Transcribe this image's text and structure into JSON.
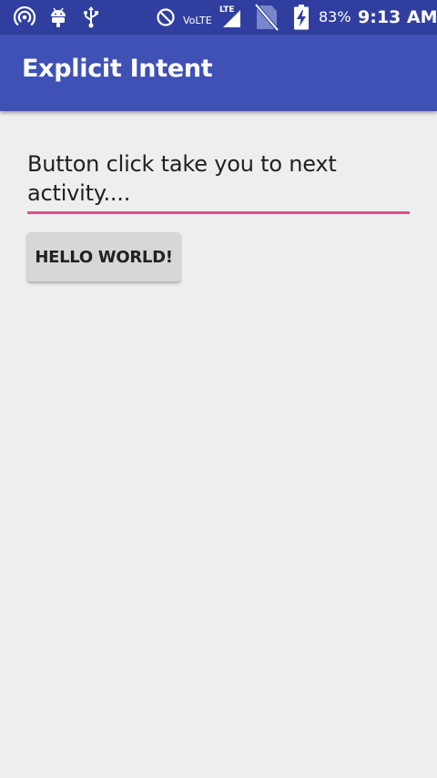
{
  "status_bar": {
    "volte_label": "VoLTE",
    "lte_label": "LTE",
    "battery_percent": "83%",
    "time": "9:13 AM",
    "icons": [
      "hotspot-icon",
      "android-debug-icon",
      "usb-icon",
      "do-not-disturb-icon",
      "signal-icon",
      "no-sim-icon",
      "battery-charging-icon"
    ],
    "background_color": "#303F9F"
  },
  "app_bar": {
    "title": "Explicit Intent",
    "background_color": "#3F51B5"
  },
  "main": {
    "edit_text_value": "Button click take you to next activity....",
    "underline_color": "#E84D8A",
    "button_label": "Hello World!"
  }
}
